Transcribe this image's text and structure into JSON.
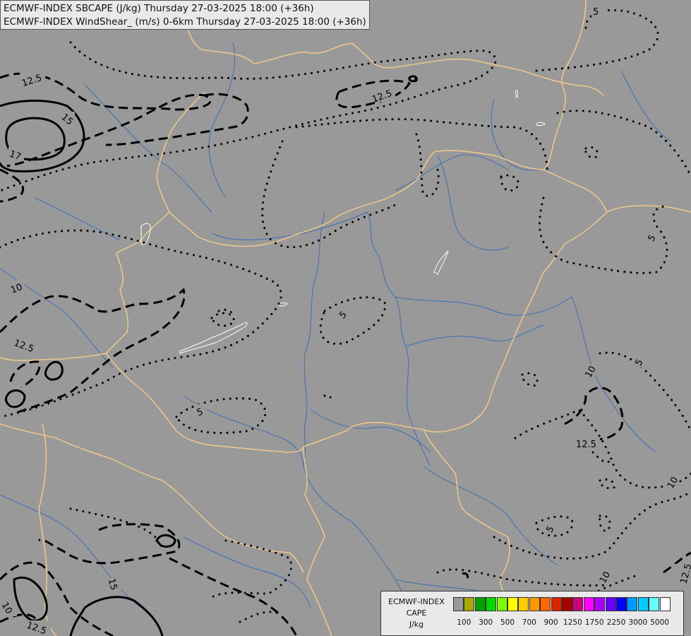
{
  "title": {
    "line1": "ECMWF-INDEX SBCAPE (J/kg) Thursday 27-03-2025 18:00 (+36h)",
    "line2": "ECMWF-INDEX WindShear_ (m/s) 0-6km Thursday 27-03-2025 18:00 (+36h)"
  },
  "legend": {
    "line1": "ECMWF-INDEX",
    "line2": "CAPE",
    "line3": "J/kg",
    "colors": [
      "#999999",
      "#aaa800",
      "#00a000",
      "#00d800",
      "#7aff00",
      "#ffff00",
      "#ffcc00",
      "#ff9900",
      "#ff6600",
      "#dd2200",
      "#aa0000",
      "#cc0077",
      "#ff00ff",
      "#aa00ff",
      "#6600ff",
      "#0000ff",
      "#0099ff",
      "#00ccff",
      "#66ffff",
      "#ffffff"
    ],
    "ticks": [
      "100",
      "300",
      "500",
      "700",
      "900",
      "1250",
      "1750",
      "2250",
      "3000",
      "5000"
    ]
  },
  "contour_labels": [
    "5",
    "12.5",
    "15",
    "17",
    "12.5",
    "10",
    "12.5",
    "5",
    "5",
    "5",
    "10",
    "12.5",
    "5",
    "10",
    "5",
    "10",
    "12.5",
    "15",
    "10",
    "12.5",
    "5"
  ]
}
